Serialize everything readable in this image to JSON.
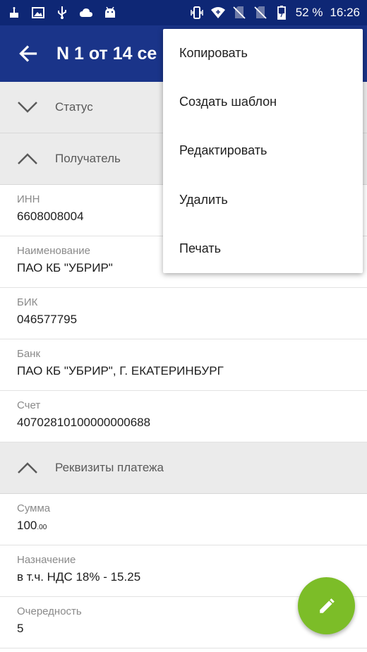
{
  "status_bar": {
    "battery": "52 %",
    "time": "16:26",
    "left_icons": [
      "cake-icon",
      "image-icon",
      "usb-icon",
      "cloud-icon",
      "android-icon"
    ],
    "right_icons": [
      "vibrate-icon",
      "wifi-icon",
      "no-sim-icon",
      "no-sim-icon",
      "battery-icon"
    ]
  },
  "app_bar": {
    "title": "N 1 от 14 се",
    "back_icon": "arrow-back-icon",
    "background": "#1a3489"
  },
  "sections": {
    "status": {
      "label": "Статус",
      "expanded": false
    },
    "recipient": {
      "label": "Получатель",
      "expanded": true
    },
    "payment": {
      "label": "Реквизиты платежа",
      "expanded": true
    }
  },
  "recipient_fields": [
    {
      "label": "ИНН",
      "value": "6608008004"
    },
    {
      "label": "Наименование",
      "value": "ПАО КБ \"УБРИР\""
    },
    {
      "label": "БИК",
      "value": "046577795"
    },
    {
      "label": "Банк",
      "value": "ПАО КБ \"УБРИР\", Г. ЕКАТЕРИНБУРГ"
    },
    {
      "label": "Счет",
      "value": "40702810100000000688"
    }
  ],
  "payment_fields": {
    "amount": {
      "label": "Сумма",
      "value_main": "100",
      "value_cents": ".00"
    },
    "purpose": {
      "label": "Назначение",
      "value": "в т.ч. НДС 18% - 15.25"
    },
    "priority": {
      "label": "Очередность",
      "value": "5"
    }
  },
  "menu": {
    "items": [
      "Копировать",
      "Создать шаблон",
      "Редактировать",
      "Удалить",
      "Печать"
    ]
  },
  "fab": {
    "icon": "pencil-icon",
    "color": "#7cbd28"
  }
}
